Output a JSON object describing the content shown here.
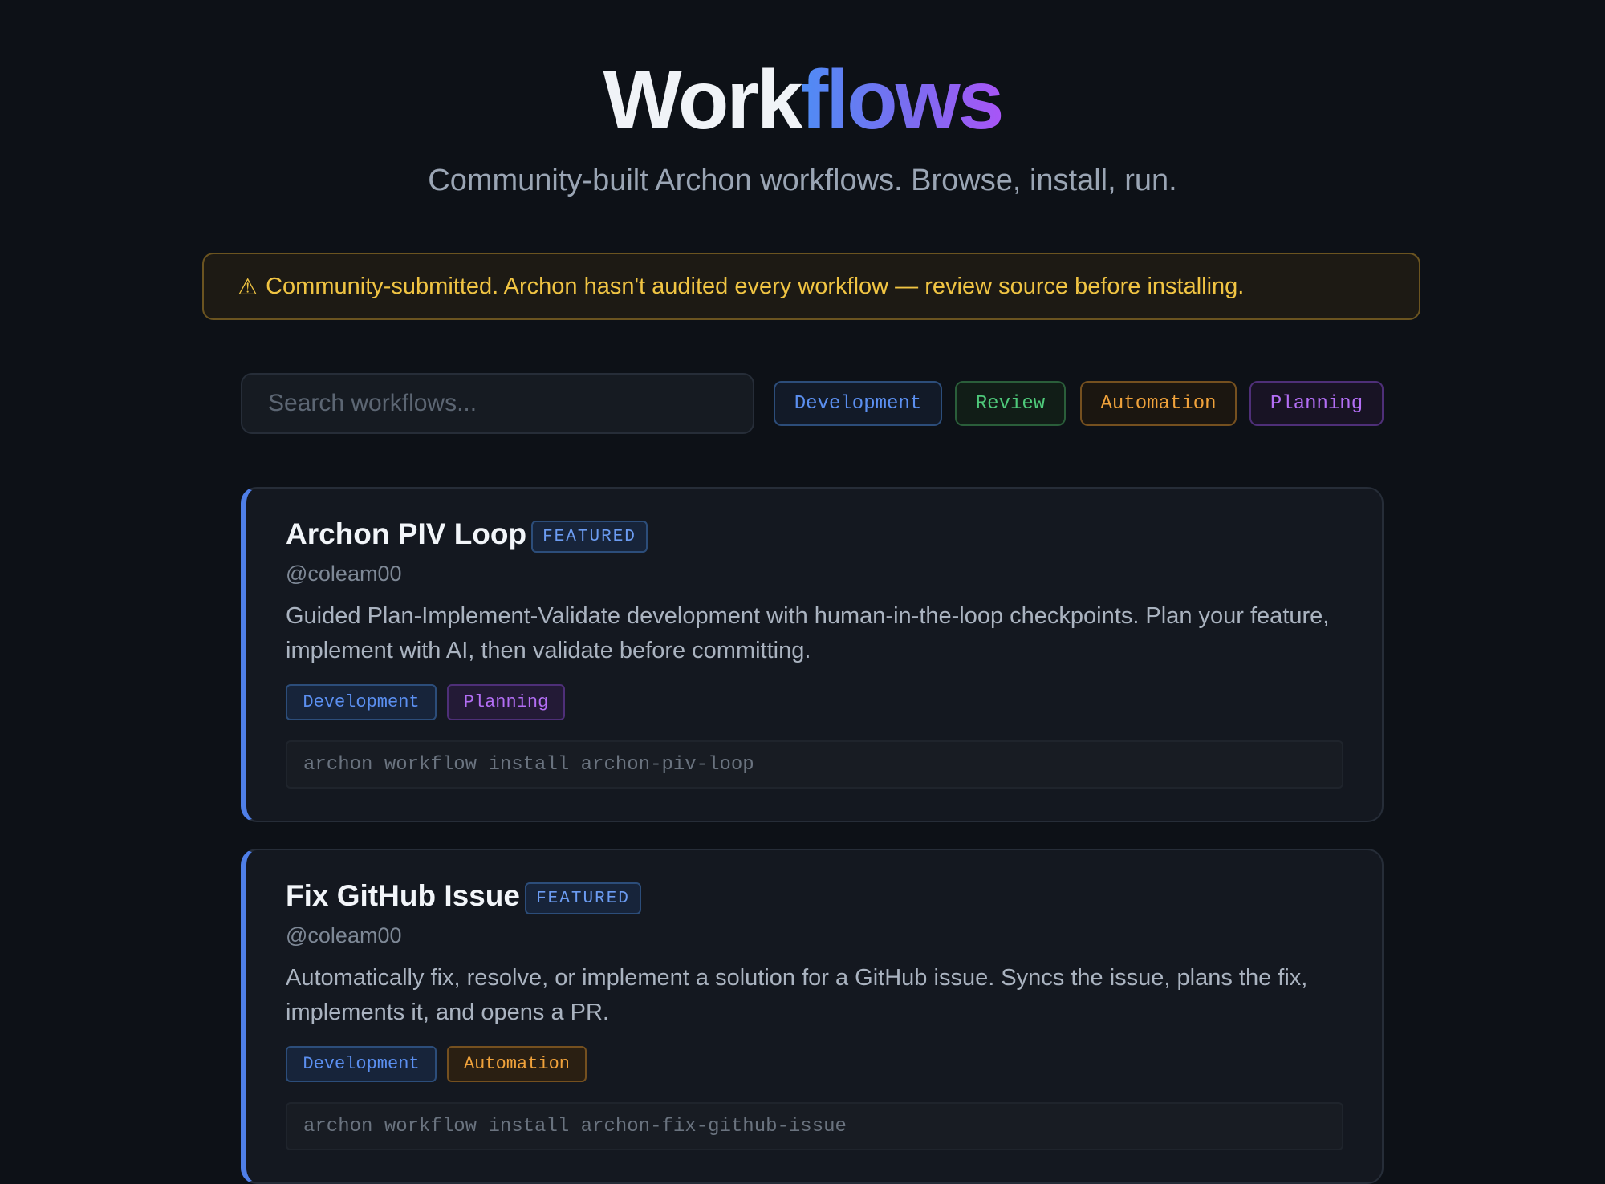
{
  "hero": {
    "title_part1": "Work",
    "title_part2": "flows",
    "subtitle": "Community-built Archon workflows. Browse, install, run."
  },
  "warning": {
    "icon": "warning-icon",
    "icon_glyph": "⚠",
    "text": "Community-submitted. Archon hasn't audited every workflow — review source before installing."
  },
  "search": {
    "placeholder": "Search workflows...",
    "value": ""
  },
  "filters": [
    {
      "label": "Development",
      "color": "#5b8ff0"
    },
    {
      "label": "Review",
      "color": "#4ec97a"
    },
    {
      "label": "Automation",
      "color": "#f0a23b"
    },
    {
      "label": "Planning",
      "color": "#b36ef5"
    }
  ],
  "workflows": [
    {
      "title": "Archon PIV Loop",
      "badge": "FEATURED",
      "author": "@coleam00",
      "description": "Guided Plan-Implement-Validate development with human-in-the-loop checkpoints. Plan your feature, implement with AI, then validate before committing.",
      "tags": [
        "Development",
        "Planning"
      ],
      "install_command": "archon workflow install archon-piv-loop"
    },
    {
      "title": "Fix GitHub Issue",
      "badge": "FEATURED",
      "author": "@coleam00",
      "description": "Automatically fix, resolve, or implement a solution for a GitHub issue. Syncs the issue, plans the fix, implements it, and opens a PR.",
      "tags": [
        "Development",
        "Automation"
      ],
      "install_command": "archon workflow install archon-fix-github-issue"
    }
  ],
  "colors": {
    "background": "#0d1117",
    "accent_blue": "#4f7fe8",
    "accent_purple": "#a855f7",
    "warning_text": "#f0c443"
  }
}
